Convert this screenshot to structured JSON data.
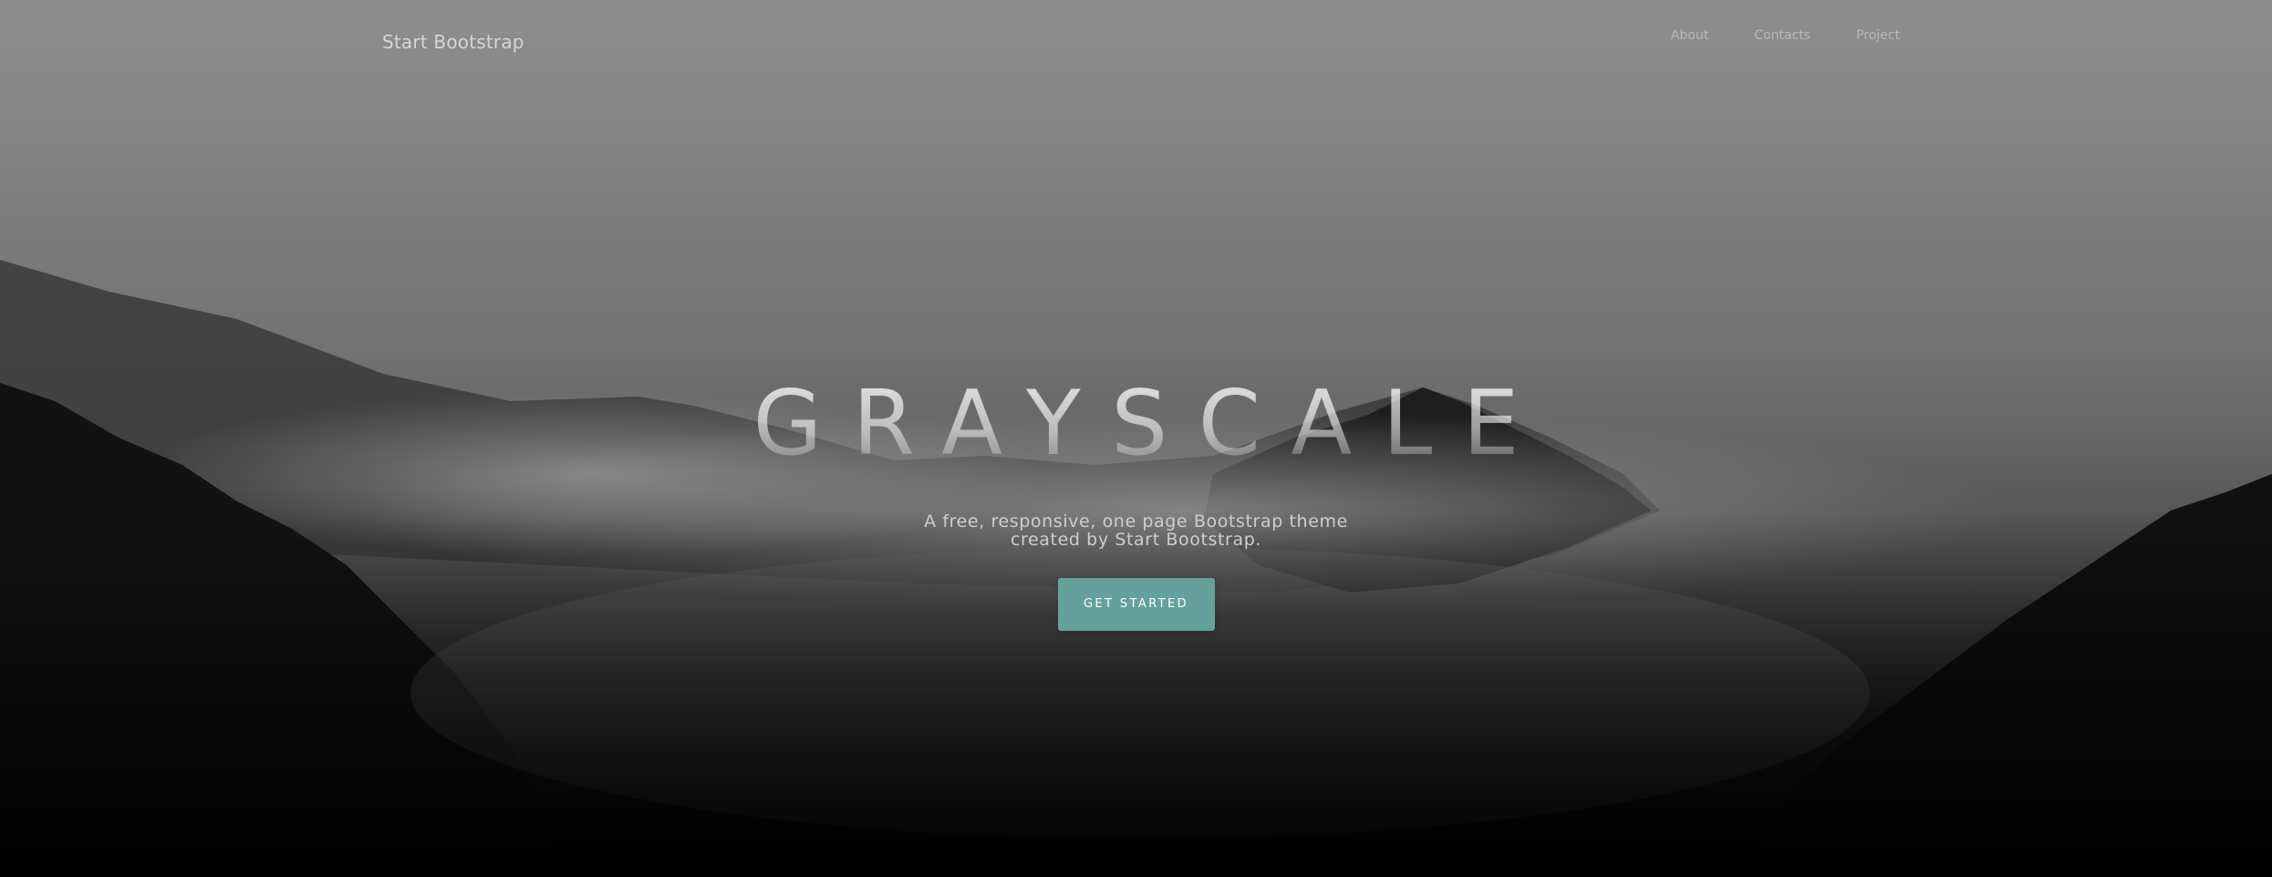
{
  "navbar": {
    "brand": "Start Bootstrap",
    "links": [
      {
        "label": "About"
      },
      {
        "label": "Contacts"
      },
      {
        "label": "Project"
      }
    ]
  },
  "hero": {
    "title": "GRAYSCALE",
    "subtitle": "A free, responsive, one page Bootstrap theme created by Start Bootstrap.",
    "button_label": "GET STARTED"
  },
  "colors": {
    "accent": "#64a19d",
    "nav_text": "#b9b9b9"
  }
}
